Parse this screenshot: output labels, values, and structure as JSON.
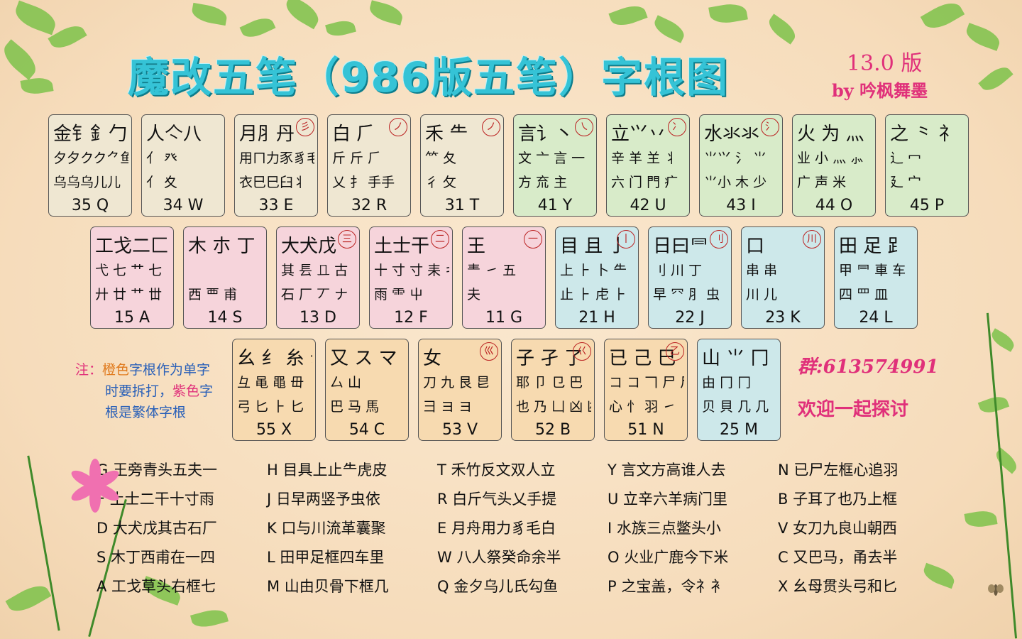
{
  "header": {
    "title": "魔改五笔（986版五笔）字根图",
    "version": "13.0 版",
    "byline": "by 吟枫舞墨"
  },
  "colors": {
    "green": "#d8ebc9",
    "beige": "#efe7d2",
    "pink": "#f6d4db",
    "blue": "#cde8ea",
    "orange": "#f7dab0",
    "highlight_orange": "#e07a1e",
    "highlight_purple": "#e0307a"
  },
  "keys": [
    {
      "r1": "金钅釒勹",
      "r2": "夕夕クク⺈鱼",
      "r3": "乌乌乌儿儿",
      "circle": "",
      "label": "35 Q",
      "color": "beige"
    },
    {
      "r1": "人亽八",
      "r2": "亻 癶",
      "r3": "亻 夊",
      "circle": "",
      "label": "34 W",
      "color": "beige"
    },
    {
      "r1": "月⺼丹",
      "r2": "用ㄇ力豕豸毛",
      "r3": "衣⺒⺒臼⺦",
      "circle": "彡",
      "label": "33 E",
      "color": "beige"
    },
    {
      "r1": "白 ⺁",
      "r2": "斤 斤 ⺁",
      "r3": "乂 扌 手手",
      "circle": "ノ",
      "label": "32 R",
      "color": "beige"
    },
    {
      "r1": "禾 ⺧",
      "r2": "⺮ 夂",
      "r3": "彳 攵",
      "circle": "ノ",
      "label": "31 T",
      "color": "beige"
    },
    {
      "r1": "言讠丶",
      "r2": "文 亠 言 一",
      "r3": "方 㐬 主",
      "circle": "㇏",
      "label": "41 Y",
      "color": "green"
    },
    {
      "r1": "立⺍丷",
      "r2": "辛 羊 𦍌 丬",
      "r3": "六 门 門 疒",
      "circle": "冫",
      "label": "42 U",
      "color": "green"
    },
    {
      "r1": "水氺氺",
      "r2": "⺌⺍ 氵 ⺌",
      "r3": "⺌小 木 少",
      "circle": "氵",
      "label": "43 I",
      "color": "green"
    },
    {
      "r1": "火 为 灬",
      "r2": "业 小 灬 ⺗",
      "r3": "广 声 米",
      "circle": "",
      "label": "44 O",
      "color": "green"
    },
    {
      "r1": "之 ⺀ 礻",
      "r2": "辶 冖",
      "r3": "廴 宀",
      "circle": "",
      "label": "45 P",
      "color": "green"
    },
    {
      "r1": "工戈⼆匚",
      "r2": "弋 七 艹 七",
      "r3": "廾 廿 艹 丗",
      "circle": "",
      "label": "15 A",
      "color": "pink"
    },
    {
      "r1": "木 朩 丁",
      "r2": "",
      "r3": "西 覀 甫",
      "circle": "",
      "label": "14 S",
      "color": "pink"
    },
    {
      "r1": "大犬戊",
      "r2": "其 镸 𠀃 古",
      "r3": "石 厂 丆 ナ",
      "circle": "三",
      "label": "13 D",
      "color": "pink"
    },
    {
      "r1": "土士干",
      "r2": "十 寸 寸 耒 キ",
      "r3": "雨 ⻗ 屮",
      "circle": "二",
      "label": "12 F",
      "color": "pink"
    },
    {
      "r1": "王",
      "r2": "龶 ㇀ 五",
      "r3": "夫",
      "circle": "一",
      "label": "11 G",
      "color": "pink"
    },
    {
      "r1": "目 且 亅",
      "r2": "上 ⺊ 卜 ⺧",
      "r3": "止 ⺊ 虍 ⺊",
      "circle": "丨",
      "label": "21 H",
      "color": "blue"
    },
    {
      "r1": "日曰⺜",
      "r2": "刂 川 丁",
      "r3": "早 㓁 ⺼ 虫",
      "circle": "刂",
      "label": "22 J",
      "color": "blue"
    },
    {
      "r1": "口",
      "r2": "串 串",
      "r3": "川 儿",
      "circle": "川",
      "label": "23 K",
      "color": "blue"
    },
    {
      "r1": "田 足 ⻊ 口",
      "r2": "甲 ⺜ 車 车 ⺊",
      "r3": "四 罒 皿",
      "circle": "",
      "label": "24 L",
      "color": "blue"
    },
    {
      "r1": "幺 纟 糸 母",
      "r2": "彑 黾 黽 毌",
      "r3": "弓 匕 ⺊ 匕",
      "circle": "",
      "label": "55 X",
      "color": "orange"
    },
    {
      "r1": "又 ス マ",
      "r2": "厶 山",
      "r3": "巴 马 馬",
      "circle": "",
      "label": "54 C",
      "color": "orange"
    },
    {
      "r1": "女",
      "r2": "刀 九 艮 㫐",
      "r3": "彐 ヨ ヨ",
      "circle": "巛",
      "label": "53 V",
      "color": "orange"
    },
    {
      "r1": "子 孑 了",
      "r2": "耶 卩 ⺋ 巴",
      "r3": "也 乃 凵 凶 凼",
      "circle": "巜",
      "label": "52 B",
      "color": "orange"
    },
    {
      "r1": "已 己 巳",
      "r2": "コ コ 𠃍 尸 尸",
      "r3": "心 忄 羽 ㇀",
      "circle": "乙",
      "label": "51 N",
      "color": "orange"
    },
    {
      "r1": "山 ⺌ 冂",
      "r2": "由 冂 冂",
      "r3": "贝 貝 几 几",
      "circle": "",
      "label": "25 M",
      "color": "blue"
    }
  ],
  "note": {
    "line1_prefix": "注：",
    "line1_orange": "橙色",
    "line1_rest": "字根作为单字",
    "line2_a": "时要拆打，",
    "line2_purple": "紫色",
    "line2_b": "字",
    "line3": "根是繁体字根"
  },
  "group": "群:613574991",
  "welcome": "欢迎一起探讨",
  "tips": [
    [
      "G 王旁青头五夫一",
      "H 目具上止⺧虎皮",
      "T 禾竹反文双人立",
      "Y 言文方高谁人去",
      "N 已尸左框心追羽"
    ],
    [
      "F 土士二干十寸雨",
      "J 日早两竖予虫依",
      "R 白斤气头乂手提",
      "U 立辛六羊病门里",
      "B 子耳了也乃上框"
    ],
    [
      "D 大犬戊其古石厂",
      "K 口与川流革囊聚",
      "E 月舟用力豸毛白",
      "I 水族三点鳖头小",
      "V 女刀九良山朝西"
    ],
    [
      "S 木丁西甫在一四",
      "L 田甲足框四车里",
      "W 八人祭癸命余半",
      "O 火业广鹿今下米",
      "C 又巴马，甬去半"
    ],
    [
      "A 工戈草头右框七",
      "M 山由贝骨下框几",
      "Q 金夕乌儿氏勾鱼",
      "P 之宝盖，令礻衤",
      "X 幺母贯头弓和匕"
    ]
  ]
}
